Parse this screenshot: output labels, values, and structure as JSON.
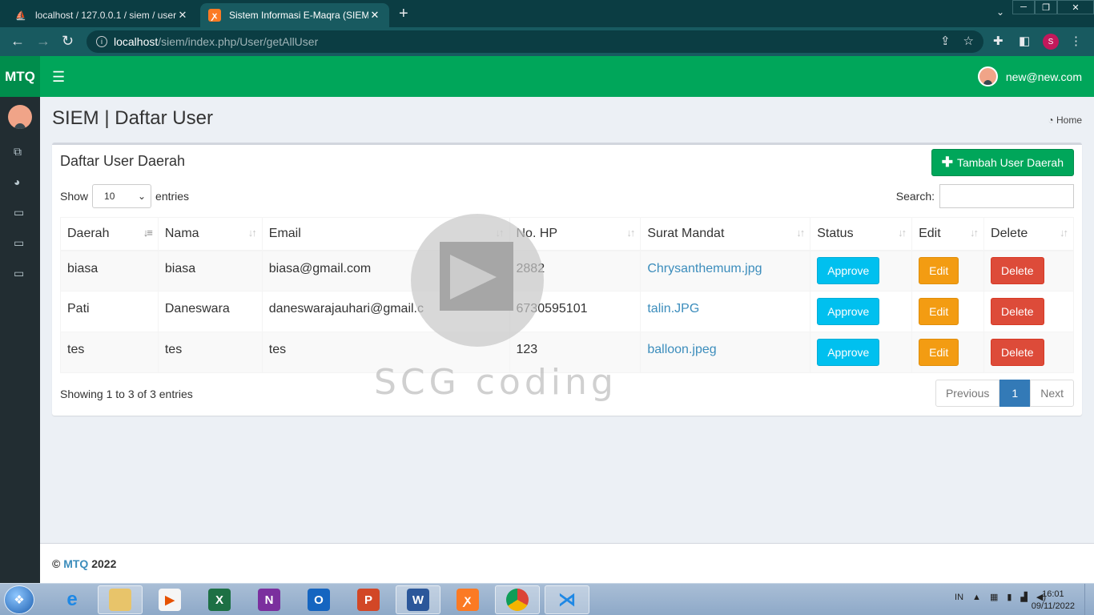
{
  "browser": {
    "tabs": [
      {
        "title": "localhost / 127.0.0.1 / siem / user",
        "favicon": "phpmyadmin-icon"
      },
      {
        "title": "Sistem Informasi E-Maqra (SIEM)",
        "favicon": "xampp-icon"
      }
    ],
    "url_host": "localhost",
    "url_path": "/siem/index.php/User/getAllUser",
    "profile_initial": "S"
  },
  "app": {
    "logo": "MTQ",
    "user_email": "new@new.com",
    "page_title": "SIEM | Daftar User",
    "breadcrumb": "Home"
  },
  "box": {
    "title": "Daftar User Daerah",
    "add_button": "Tambah User Daerah",
    "show_label": "Show",
    "entries_value": "10",
    "entries_label": "entries",
    "search_label": "Search:"
  },
  "table": {
    "headers": [
      "Daerah",
      "Nama",
      "Email",
      "No. HP",
      "Surat Mandat",
      "Status",
      "Edit",
      "Delete"
    ],
    "rows": [
      {
        "daerah": "biasa",
        "nama": "biasa",
        "email": "biasa@gmail.com",
        "hp": "2882",
        "surat": "Chrysanthemum.jpg",
        "status": "Approve",
        "edit": "Edit",
        "delete": "Delete"
      },
      {
        "daerah": "Pati",
        "nama": "Daneswara",
        "email": "daneswarajauhari@gmail.c",
        "hp": "6730595101",
        "surat": "talin.JPG",
        "status": "Approve",
        "edit": "Edit",
        "delete": "Delete"
      },
      {
        "daerah": "tes",
        "nama": "tes",
        "email": "tes",
        "hp": "123",
        "surat": "balloon.jpeg",
        "status": "Approve",
        "edit": "Edit",
        "delete": "Delete"
      }
    ]
  },
  "pagination": {
    "info": "Showing 1 to 3 of 3 entries",
    "previous": "Previous",
    "current": "1",
    "next": "Next"
  },
  "watermark": "SCG coding",
  "footer": {
    "copyright": "©",
    "brand": "MTQ",
    "year": "2022"
  },
  "taskbar": {
    "lang": "IN",
    "time": "16:01",
    "date": "09/11/2022"
  },
  "colors": {
    "header_green": "#00a65a",
    "sidebar_dark": "#222d32",
    "link_blue": "#3c8dbc"
  }
}
